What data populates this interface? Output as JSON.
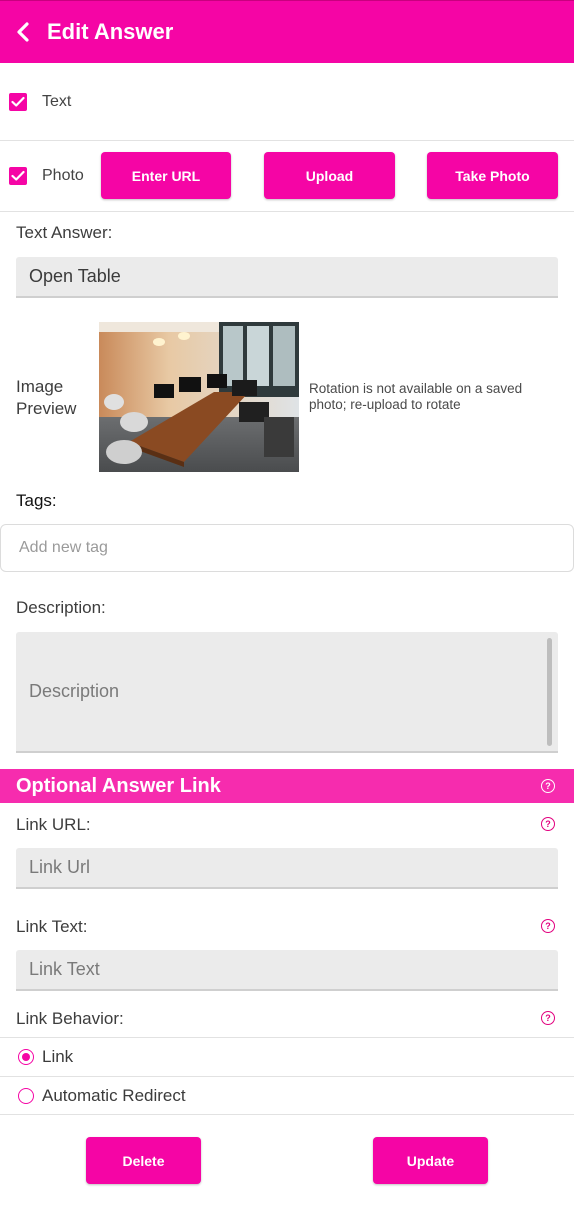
{
  "header": {
    "title": "Edit Answer",
    "back_icon": "chevron-left-icon"
  },
  "options": {
    "text_label": "Text",
    "photo_label": "Photo",
    "enter_url_label": "Enter URL",
    "upload_label": "Upload",
    "take_photo_label": "Take Photo"
  },
  "text_answer": {
    "label": "Text Answer:",
    "value": "Open Table"
  },
  "image_preview": {
    "label_line1": "Image",
    "label_line2": "Preview",
    "note": "Rotation is not available on a saved photo; re-upload to rotate"
  },
  "tags": {
    "label": "Tags:",
    "placeholder": "Add new tag"
  },
  "description": {
    "label": "Description:",
    "placeholder": "Description"
  },
  "link_section": {
    "title": "Optional Answer Link",
    "url_label": "Link URL:",
    "url_placeholder": "Link Url",
    "text_label": "Link Text:",
    "text_placeholder": "Link Text",
    "behavior_label": "Link Behavior:",
    "behavior_options": [
      "Link",
      "Automatic Redirect"
    ],
    "behavior_selected": "Link"
  },
  "actions": {
    "delete_label": "Delete",
    "update_label": "Update"
  },
  "colors": {
    "accent": "#f505a5",
    "section_bar": "#f62cae"
  }
}
